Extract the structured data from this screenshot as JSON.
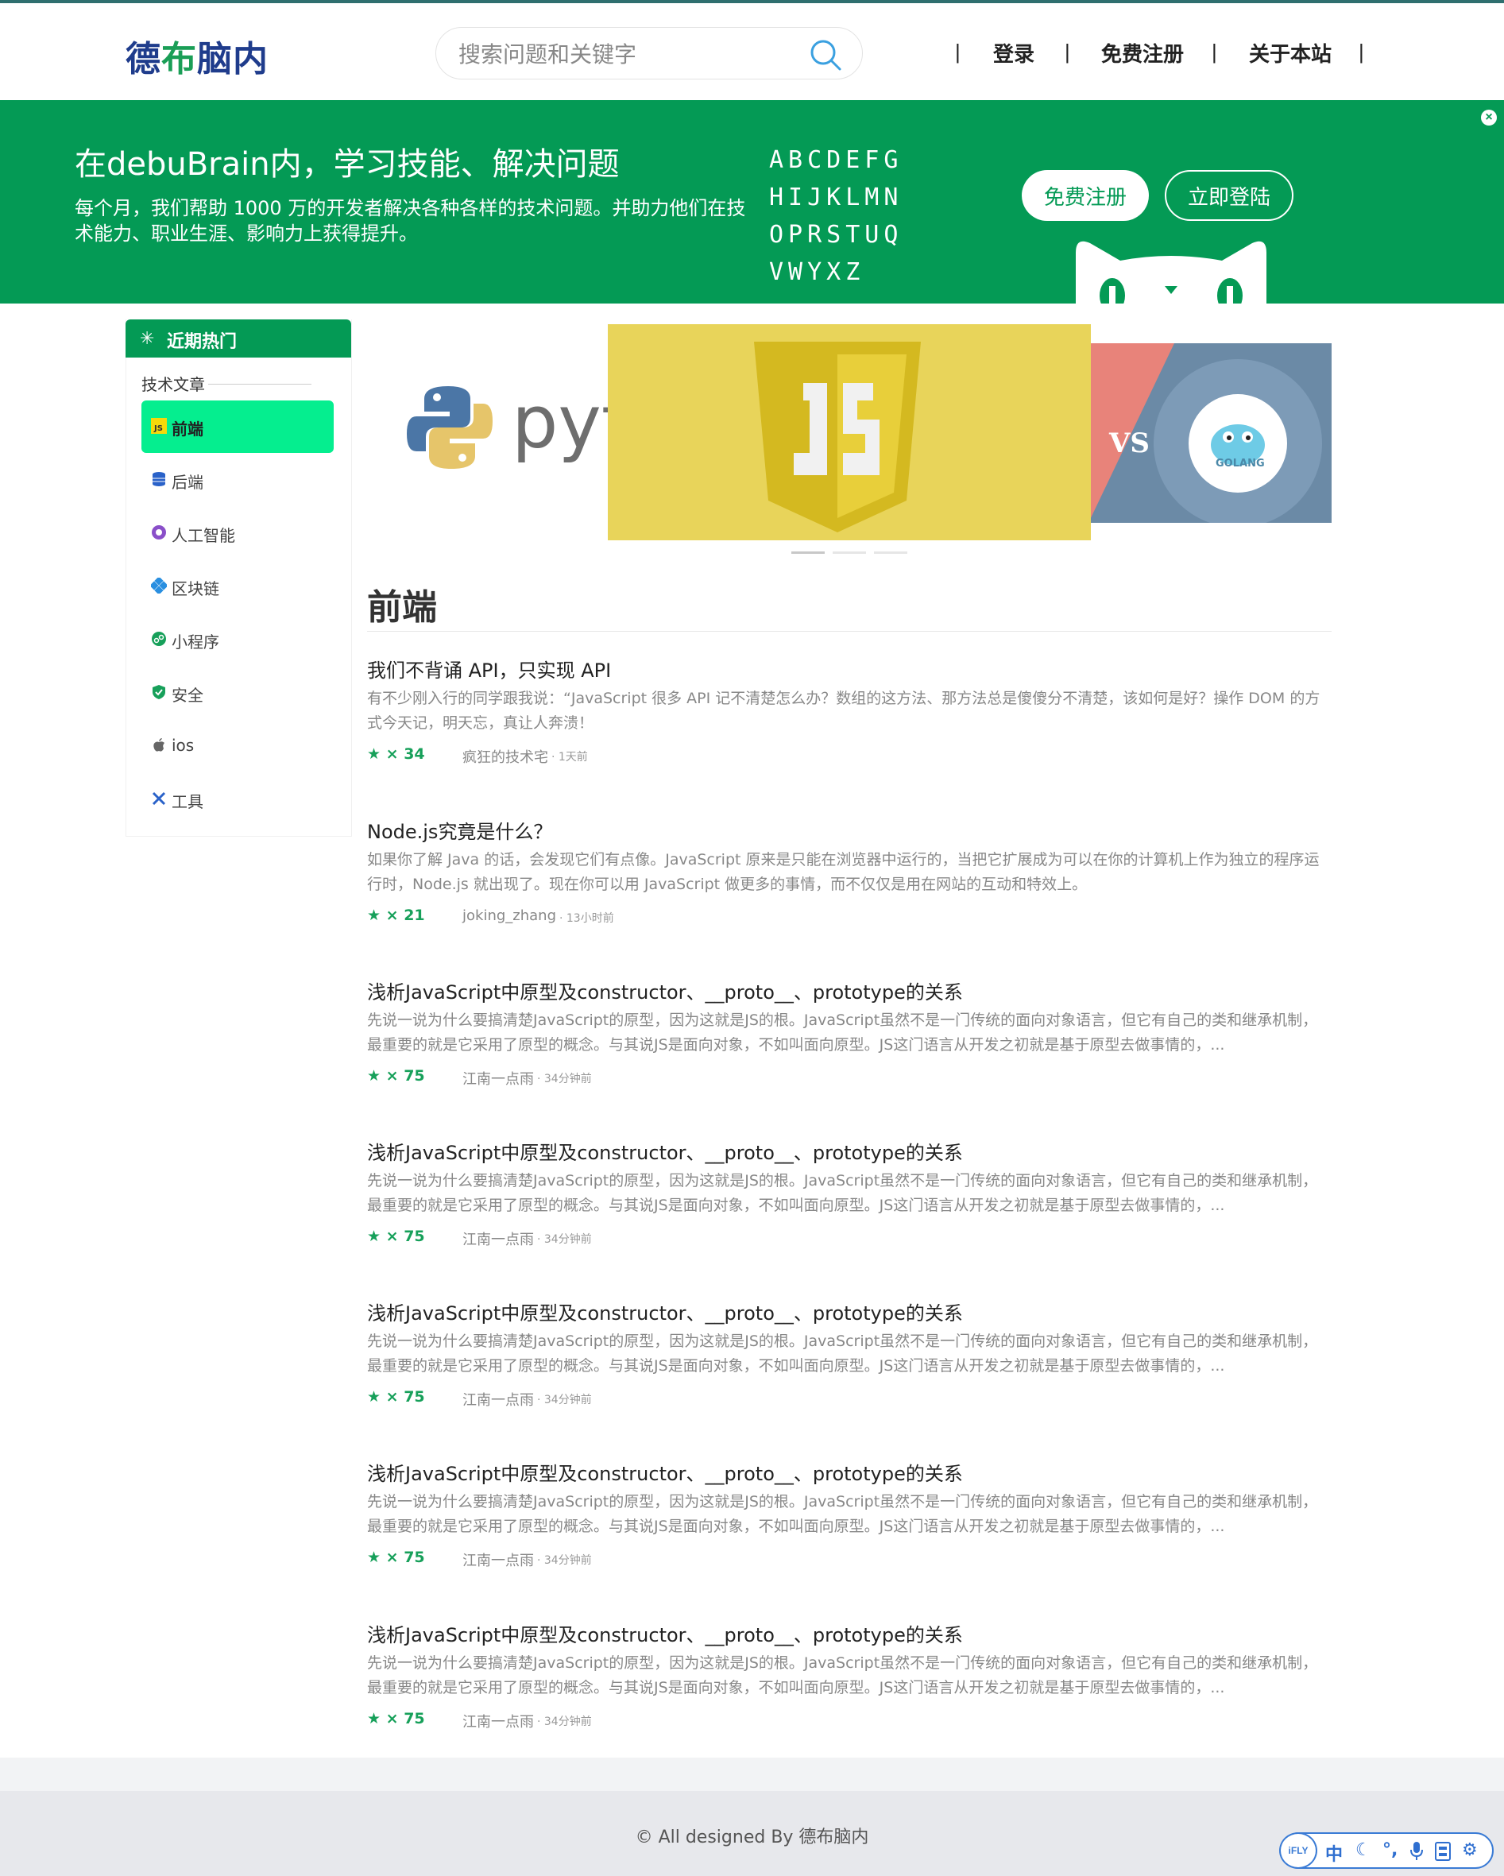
{
  "header": {
    "logo_part1": "德",
    "logo_part2": "布",
    "logo_part3": "脑内",
    "search_placeholder": "搜索问题和关键字",
    "nav": [
      "登录",
      "免费注册",
      "关于本站"
    ],
    "separator": "|"
  },
  "banner": {
    "title": "在debuBrain内，学习技能、解决问题",
    "subtitle": "每个月，我们帮助 1000 万的开发者解决各种各样的技术问题。并助力他们在技术能力、职业生涯、影响力上获得提升。",
    "alphabet": [
      "ABCDEFG",
      "HIJKLMN",
      "OPRSTUQ",
      "VWYXZ"
    ],
    "register_label": "免费注册",
    "login_label": "立即登陆",
    "close_label": "×"
  },
  "sidebar": {
    "header": "近期热门",
    "subheader": "技术文章",
    "items": [
      {
        "label": "前端",
        "icon": "js-icon",
        "color": "#f5d90a",
        "active": true
      },
      {
        "label": "后端",
        "icon": "database-icon",
        "color": "#2a62c9",
        "active": false
      },
      {
        "label": "人工智能",
        "icon": "brain-icon",
        "color": "#8a4fc9",
        "active": false
      },
      {
        "label": "区块链",
        "icon": "blockchain-icon",
        "color": "#2a8fe0",
        "active": false
      },
      {
        "label": "小程序",
        "icon": "miniprogram-icon",
        "color": "#17a05a",
        "active": false
      },
      {
        "label": "安全",
        "icon": "shield-icon",
        "color": "#17a05a",
        "active": false
      },
      {
        "label": "ios",
        "icon": "apple-icon",
        "color": "#666666",
        "active": false
      },
      {
        "label": "工具",
        "icon": "tools-icon",
        "color": "#2a62c9",
        "active": false
      }
    ]
  },
  "carousel": {
    "slides": [
      "python",
      "JS",
      "golang"
    ],
    "python_text": "pyt",
    "vs_text": "VS",
    "golang_text": "GOLANG",
    "active_index": 0
  },
  "section_title": "前端",
  "articles": [
    {
      "title": "我们不背诵 API，只实现 API",
      "desc": "有不少刚入行的同学跟我说：“JavaScript 很多 API 记不清楚怎么办？数组的这方法、那方法总是傻傻分不清楚，该如何是好？操作 DOM 的方式今天记，明天忘，真让人奔溃！",
      "stars": "× 34",
      "author": "疯狂的技术宅",
      "time": "· 1天前"
    },
    {
      "title": "Node.js究竟是什么？",
      "desc": "如果你了解 Java 的话，会发现它们有点像。JavaScript 原来是只能在浏览器中运行的，当把它扩展成为可以在你的计算机上作为独立的程序运行时，Node.js 就出现了。现在你可以用 JavaScript 做更多的事情，而不仅仅是用在网站的互动和特效上。",
      "stars": "× 21",
      "author": "joking_zhang",
      "time": "· 13小时前"
    },
    {
      "title": "浅析JavaScript中原型及constructor、__proto__、prototype的关系",
      "desc": "先说一说为什么要搞清楚JavaScript的原型，因为这就是JS的根。JavaScript虽然不是一门传统的面向对象语言，但它有自己的类和继承机制，最重要的就是它采用了原型的概念。与其说JS是面向对象，不如叫面向原型。JS这门语言从开发之初就是基于原型去做事情的，...",
      "stars": "× 75",
      "author": "江南一点雨",
      "time": "· 34分钟前"
    },
    {
      "title": "浅析JavaScript中原型及constructor、__proto__、prototype的关系",
      "desc": "先说一说为什么要搞清楚JavaScript的原型，因为这就是JS的根。JavaScript虽然不是一门传统的面向对象语言，但它有自己的类和继承机制，最重要的就是它采用了原型的概念。与其说JS是面向对象，不如叫面向原型。JS这门语言从开发之初就是基于原型去做事情的，...",
      "stars": "× 75",
      "author": "江南一点雨",
      "time": "· 34分钟前"
    },
    {
      "title": "浅析JavaScript中原型及constructor、__proto__、prototype的关系",
      "desc": "先说一说为什么要搞清楚JavaScript的原型，因为这就是JS的根。JavaScript虽然不是一门传统的面向对象语言，但它有自己的类和继承机制，最重要的就是它采用了原型的概念。与其说JS是面向对象，不如叫面向原型。JS这门语言从开发之初就是基于原型去做事情的，...",
      "stars": "× 75",
      "author": "江南一点雨",
      "time": "· 34分钟前"
    },
    {
      "title": "浅析JavaScript中原型及constructor、__proto__、prototype的关系",
      "desc": "先说一说为什么要搞清楚JavaScript的原型，因为这就是JS的根。JavaScript虽然不是一门传统的面向对象语言，但它有自己的类和继承机制，最重要的就是它采用了原型的概念。与其说JS是面向对象，不如叫面向原型。JS这门语言从开发之初就是基于原型去做事情的，...",
      "stars": "× 75",
      "author": "江南一点雨",
      "time": "· 34分钟前"
    },
    {
      "title": "浅析JavaScript中原型及constructor、__proto__、prototype的关系",
      "desc": "先说一说为什么要搞清楚JavaScript的原型，因为这就是JS的根。JavaScript虽然不是一门传统的面向对象语言，但它有自己的类和继承机制，最重要的就是它采用了原型的概念。与其说JS是面向对象，不如叫面向原型。JS这门语言从开发之初就是基于原型去做事情的，...",
      "stars": "× 75",
      "author": "江南一点雨",
      "time": "· 34分钟前"
    }
  ],
  "footer": {
    "copyright": "© All designed By 德布脑内"
  },
  "ime_toolbar": {
    "logo": "iFLY",
    "mode": "中",
    "icons": [
      "moon-icon",
      "punctuation-icon",
      "microphone-icon",
      "keyboard-icon",
      "settings-icon"
    ]
  },
  "colors": {
    "brand_green": "#049a55",
    "active_item": "#05ee8f",
    "logo_blue": "#1f3c8c",
    "star_green": "#17a05a"
  }
}
